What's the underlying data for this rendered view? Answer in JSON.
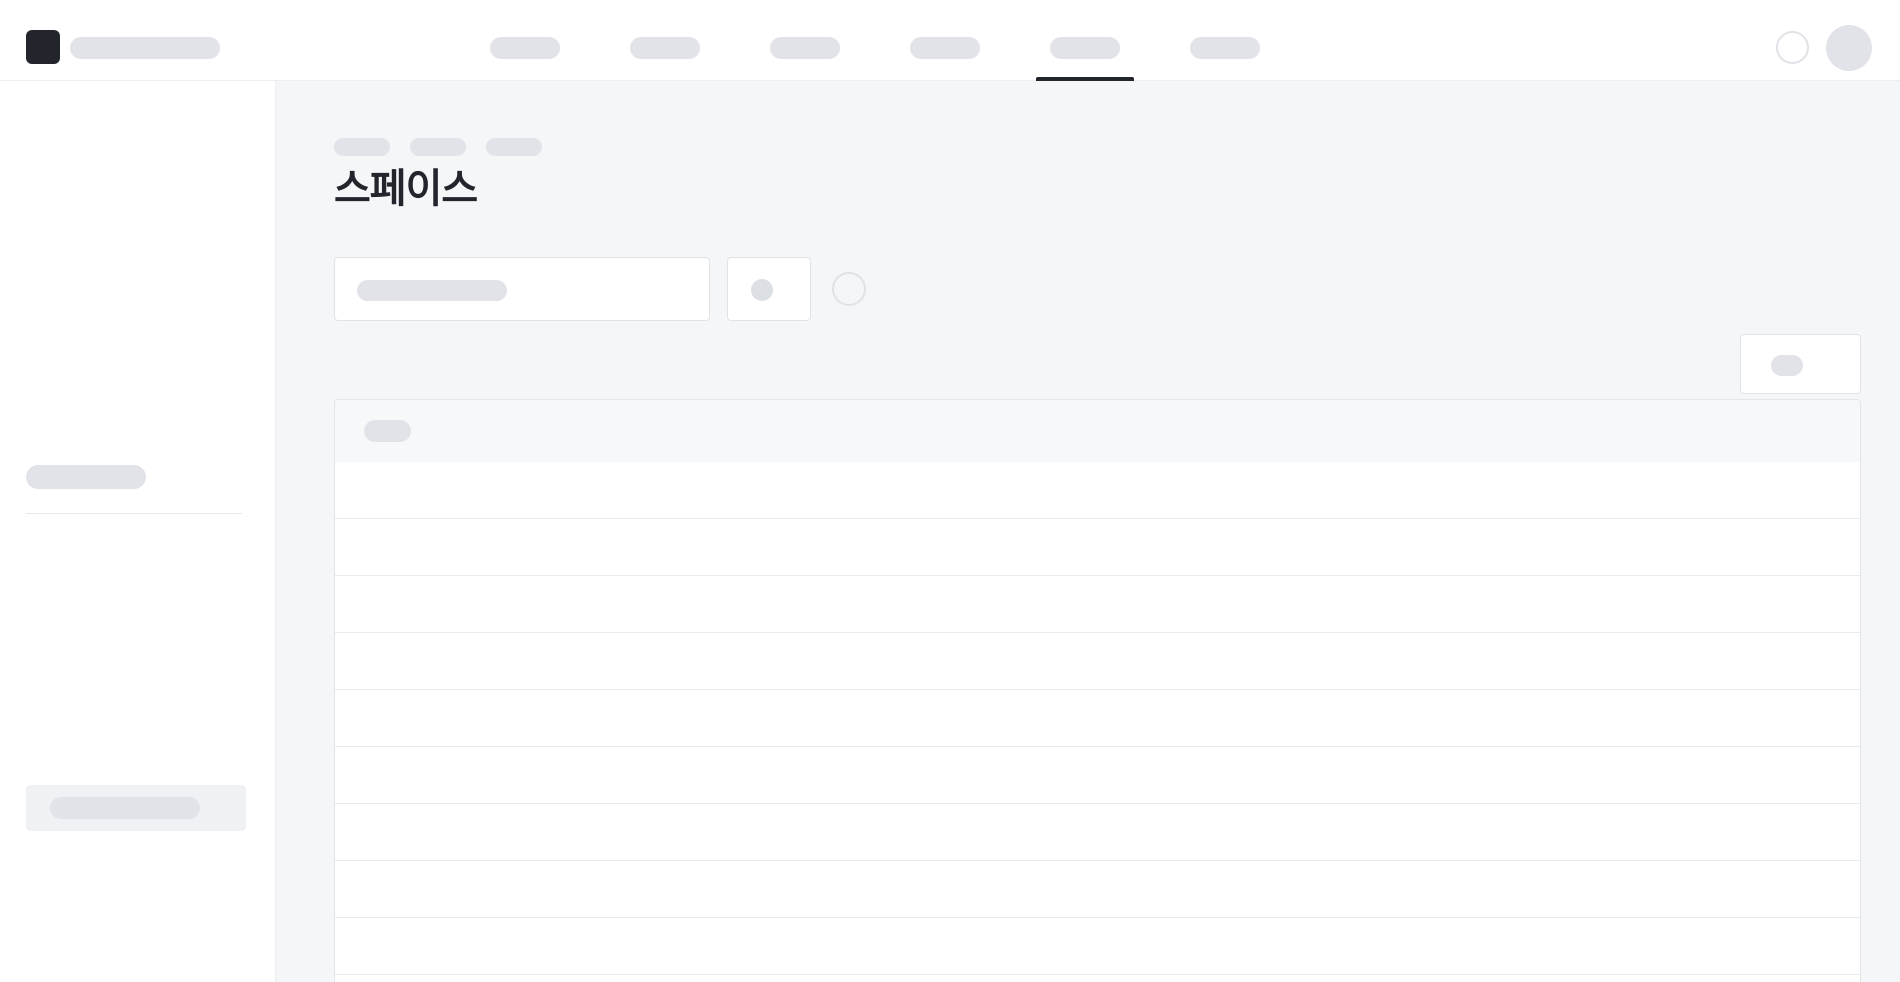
{
  "header": {
    "nav_tabs": [
      {
        "id": "nav-1",
        "active": false
      },
      {
        "id": "nav-2",
        "active": false
      },
      {
        "id": "nav-3",
        "active": false
      },
      {
        "id": "nav-4",
        "active": false
      },
      {
        "id": "nav-5",
        "active": true
      },
      {
        "id": "nav-6",
        "active": false
      }
    ]
  },
  "main": {
    "title": "스페이스"
  },
  "table": {
    "row_count": 9
  },
  "colors": {
    "accent": "#22262c",
    "background": "#f5f6f8",
    "placeholder": "#e1e3e8"
  }
}
